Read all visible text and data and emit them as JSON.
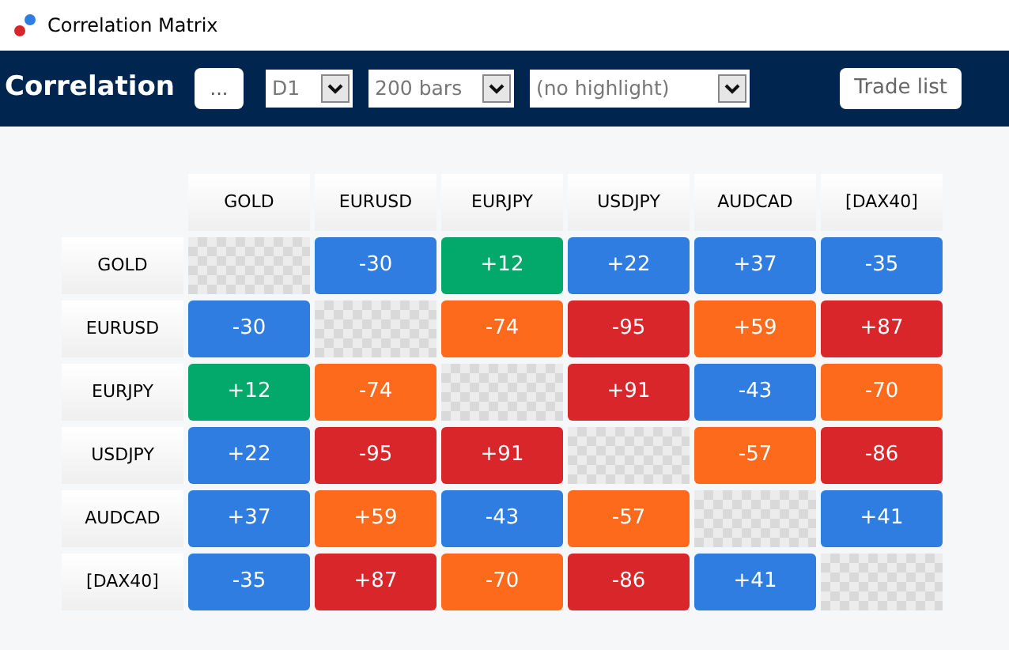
{
  "window": {
    "title": "Correlation Matrix"
  },
  "toolbar": {
    "title": "Correlation",
    "menu_button": "...",
    "dropdowns": [
      {
        "value": "D1"
      },
      {
        "value": "200 bars"
      },
      {
        "value": "(no highlight)"
      }
    ],
    "trade_list_button": "Trade list"
  },
  "matrix": {
    "columns": [
      "GOLD",
      "EURUSD",
      "EURJPY",
      "USDJPY",
      "AUDCAD",
      "[DAX40]"
    ],
    "rows": [
      {
        "label": "GOLD",
        "cells": [
          {
            "kind": "empty"
          },
          {
            "kind": "value",
            "text": "-30",
            "color": "#2f7de1"
          },
          {
            "kind": "value",
            "text": "+12",
            "color": "#03a96b"
          },
          {
            "kind": "value",
            "text": "+22",
            "color": "#2f7de1"
          },
          {
            "kind": "value",
            "text": "+37",
            "color": "#2f7de1"
          },
          {
            "kind": "value",
            "text": "-35",
            "color": "#2f7de1"
          }
        ]
      },
      {
        "label": "EURUSD",
        "cells": [
          {
            "kind": "value",
            "text": "-30",
            "color": "#2f7de1"
          },
          {
            "kind": "empty"
          },
          {
            "kind": "value",
            "text": "-74",
            "color": "#fe6a1b"
          },
          {
            "kind": "value",
            "text": "-95",
            "color": "#d8262b"
          },
          {
            "kind": "value",
            "text": "+59",
            "color": "#fe6a1b"
          },
          {
            "kind": "value",
            "text": "+87",
            "color": "#d8262b"
          }
        ]
      },
      {
        "label": "EURJPY",
        "cells": [
          {
            "kind": "value",
            "text": "+12",
            "color": "#03a96b"
          },
          {
            "kind": "value",
            "text": "-74",
            "color": "#fe6a1b"
          },
          {
            "kind": "empty"
          },
          {
            "kind": "value",
            "text": "+91",
            "color": "#d8262b"
          },
          {
            "kind": "value",
            "text": "-43",
            "color": "#2f7de1"
          },
          {
            "kind": "value",
            "text": "-70",
            "color": "#fe6a1b"
          }
        ]
      },
      {
        "label": "USDJPY",
        "cells": [
          {
            "kind": "value",
            "text": "+22",
            "color": "#2f7de1"
          },
          {
            "kind": "value",
            "text": "-95",
            "color": "#d8262b"
          },
          {
            "kind": "value",
            "text": "+91",
            "color": "#d8262b"
          },
          {
            "kind": "empty"
          },
          {
            "kind": "value",
            "text": "-57",
            "color": "#fe6a1b"
          },
          {
            "kind": "value",
            "text": "-86",
            "color": "#d8262b"
          }
        ]
      },
      {
        "label": "AUDCAD",
        "cells": [
          {
            "kind": "value",
            "text": "+37",
            "color": "#2f7de1"
          },
          {
            "kind": "value",
            "text": "+59",
            "color": "#fe6a1b"
          },
          {
            "kind": "value",
            "text": "-43",
            "color": "#2f7de1"
          },
          {
            "kind": "value",
            "text": "-57",
            "color": "#fe6a1b"
          },
          {
            "kind": "empty"
          },
          {
            "kind": "value",
            "text": "+41",
            "color": "#2f7de1"
          }
        ]
      },
      {
        "label": "[DAX40]",
        "cells": [
          {
            "kind": "value",
            "text": "-35",
            "color": "#2f7de1"
          },
          {
            "kind": "value",
            "text": "+87",
            "color": "#d8262b"
          },
          {
            "kind": "value",
            "text": "-70",
            "color": "#fe6a1b"
          },
          {
            "kind": "value",
            "text": "-86",
            "color": "#d8262b"
          },
          {
            "kind": "value",
            "text": "+41",
            "color": "#2f7de1"
          },
          {
            "kind": "empty"
          }
        ]
      }
    ]
  }
}
